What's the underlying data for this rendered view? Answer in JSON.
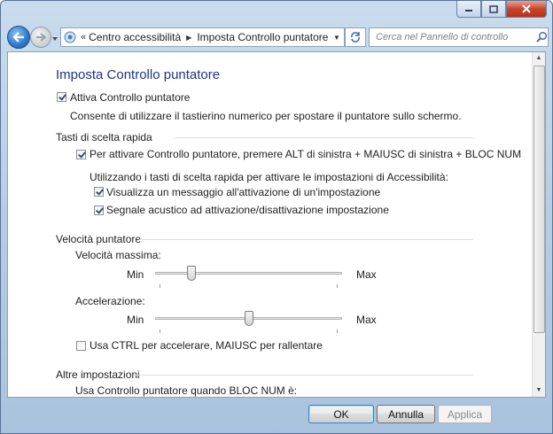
{
  "window": {
    "minimize_icon": "minimize-icon",
    "maximize_icon": "maximize-icon",
    "close_icon": "close-icon"
  },
  "nav": {
    "breadcrumbs": [
      "Centro accessibilità",
      "Imposta Controllo puntatore"
    ],
    "overflow_glyph": "«",
    "search_placeholder": "Cerca nel Pannello di controllo"
  },
  "page": {
    "title": "Imposta Controllo puntatore",
    "enable": {
      "label": "Attiva Controllo puntatore",
      "checked": true,
      "description": "Consente di utilizzare il tastierino numerico per spostare il puntatore sullo schermo."
    },
    "shortcuts": {
      "heading": "Tasti di scelta rapida",
      "shortcut_option": {
        "label": "Per attivare Controllo puntatore, premere ALT di sinistra + MAIUSC di sinistra + BLOC NUM",
        "checked": true
      },
      "subheading": "Utilizzando i tasti di scelta rapida per attivare le impostazioni di Accessibilità:",
      "warning_option": {
        "label": "Visualizza un messaggio all'attivazione di un'impostazione",
        "checked": true
      },
      "sound_option": {
        "label": "Segnale acustico ad attivazione/disattivazione impostazione",
        "checked": true
      }
    },
    "speed": {
      "heading": "Velocità puntatore",
      "max_speed": {
        "label": "Velocità massima:",
        "min_label": "Min",
        "max_label": "Max",
        "value_fraction": 0.18
      },
      "acceleration": {
        "label": "Accelerazione:",
        "min_label": "Min",
        "max_label": "Max",
        "value_fraction": 0.5
      },
      "ctrl_option": {
        "label": "Usa CTRL per accelerare, MAIUSC per rallentare",
        "checked": false
      }
    },
    "other": {
      "heading": "Altre impostazioni",
      "numlock_label": "Usa Controllo puntatore quando BLOC NUM è:"
    }
  },
  "buttons": {
    "ok": "OK",
    "cancel": "Annulla",
    "apply": "Applica"
  }
}
